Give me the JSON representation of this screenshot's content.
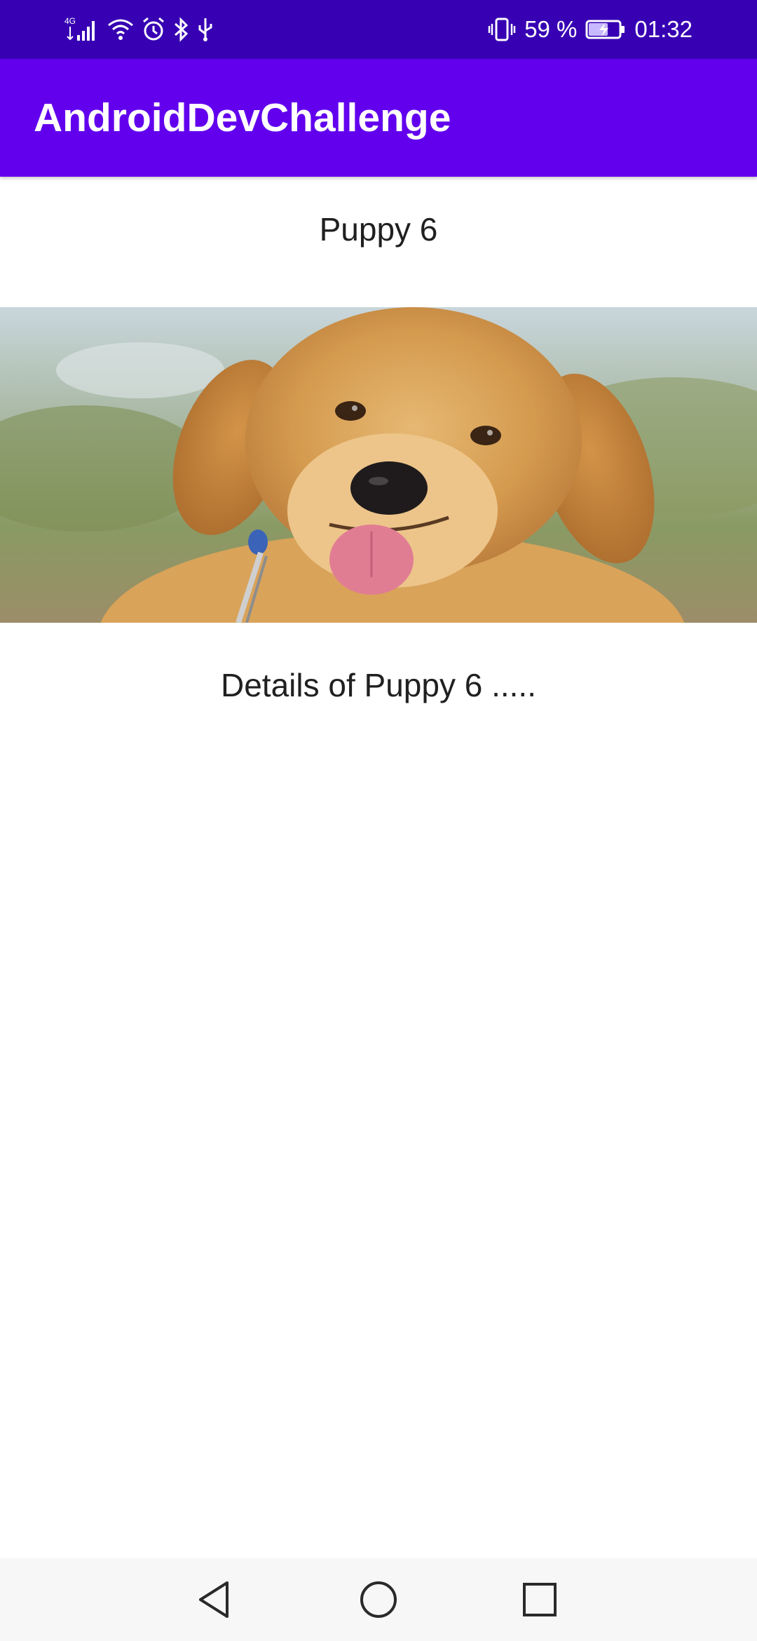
{
  "status_bar": {
    "network_label": "4G",
    "battery_percent": "59 %",
    "time": "01:32",
    "icons": [
      "signal-icon",
      "wifi-icon",
      "alarm-icon",
      "bluetooth-icon",
      "usb-icon",
      "vibrate-icon",
      "battery-charging-icon"
    ],
    "battery_level": 0.59
  },
  "app_bar": {
    "title": "AndroidDevChallenge"
  },
  "content": {
    "puppy_title": "Puppy 6",
    "puppy_details": "Details of Puppy 6 .....",
    "photo_subject": "golden retriever puppy"
  },
  "nav_bar": {
    "icons": [
      "back-icon",
      "home-icon",
      "recents-icon"
    ]
  },
  "colors": {
    "status_bar": "#3700b3",
    "app_bar": "#6200ee",
    "text": "#202020",
    "nav_bar": "#f7f7f7"
  }
}
